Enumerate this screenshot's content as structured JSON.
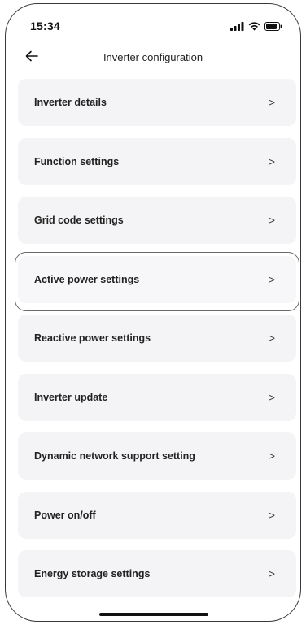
{
  "status_bar": {
    "time": "15:34",
    "icons": [
      "signal-icon",
      "wifi-icon",
      "battery-icon"
    ]
  },
  "header": {
    "back_icon": "arrow-left-icon",
    "title": "Inverter configuration"
  },
  "menu": {
    "chevron": ">",
    "items": [
      {
        "label": "Inverter details"
      },
      {
        "label": "Function settings"
      },
      {
        "label": "Grid code settings"
      },
      {
        "label": "Active power settings",
        "selected": true
      },
      {
        "label": "Reactive power settings"
      },
      {
        "label": "Inverter update"
      },
      {
        "label": "Dynamic network support setting"
      },
      {
        "label": "Power on/off"
      },
      {
        "label": "Energy storage settings"
      }
    ]
  },
  "colors": {
    "card_background": "#f4f4f6",
    "text": "#222222",
    "highlight_border": "#6a6a6a"
  }
}
